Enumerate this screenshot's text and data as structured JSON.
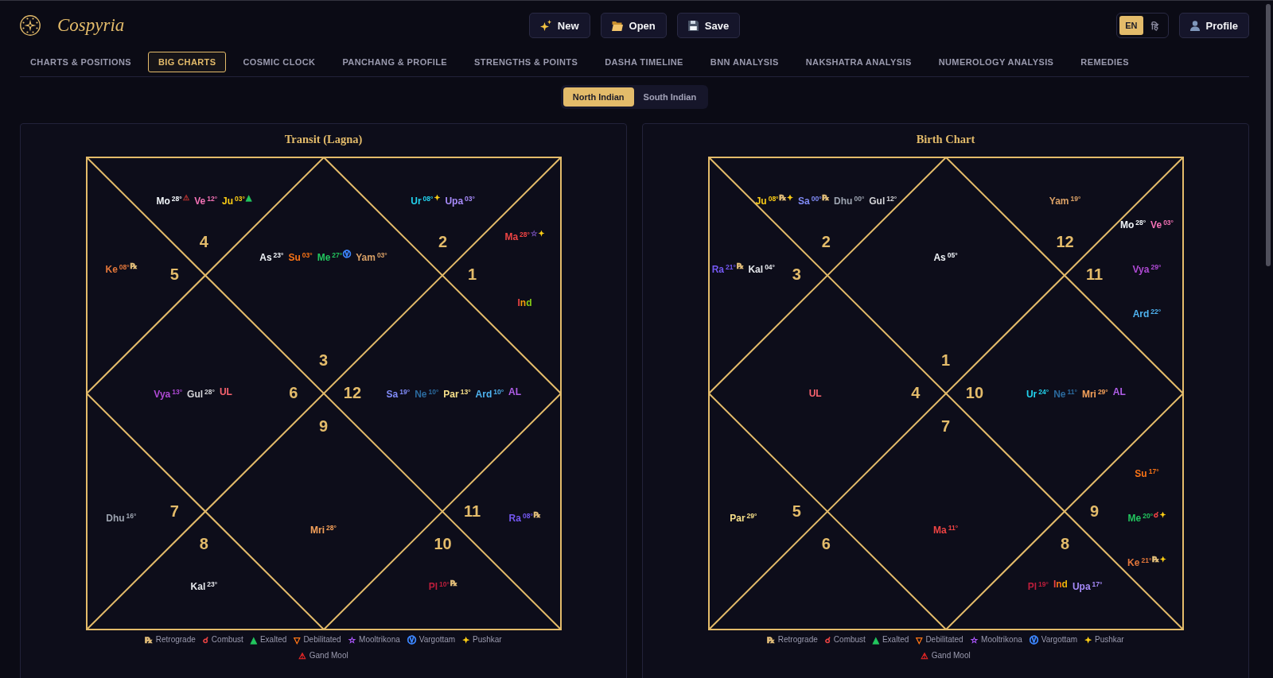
{
  "header": {
    "brand": "Cospyria",
    "buttons": [
      {
        "kind": "new",
        "label": "New"
      },
      {
        "kind": "open",
        "label": "Open"
      },
      {
        "kind": "save",
        "label": "Save"
      }
    ],
    "languages": [
      {
        "label": "EN",
        "selected": true
      },
      {
        "label": "हि",
        "selected": false
      }
    ],
    "profile": {
      "label": "Profile"
    }
  },
  "tabs": [
    {
      "label": "CHARTS & POSITIONS",
      "selected": false
    },
    {
      "label": "BIG CHARTS",
      "selected": true
    },
    {
      "label": "COSMIC CLOCK",
      "selected": false
    },
    {
      "label": "PANCHANG & PROFILE",
      "selected": false
    },
    {
      "label": "STRENGTHS & POINTS",
      "selected": false
    },
    {
      "label": "DASHA TIMELINE",
      "selected": false
    },
    {
      "label": "BNN ANALYSIS",
      "selected": false
    },
    {
      "label": "NAKSHATRA ANALYSIS",
      "selected": false
    },
    {
      "label": "NUMEROLOGY ANALYSIS",
      "selected": false
    },
    {
      "label": "REMEDIES",
      "selected": false
    }
  ],
  "chart_styles": [
    {
      "label": "North Indian",
      "selected": true
    },
    {
      "label": "South Indian",
      "selected": false
    }
  ],
  "charts": [
    {
      "title": "Transit (Lagna)",
      "houses": [
        {
          "sign": "3",
          "rows": [
            [
              {
                "name": "As",
                "degree": "23°",
                "color": "#f1f5f9"
              },
              {
                "name": "Su",
                "degree": "03°",
                "color": "#f97316"
              },
              {
                "name": "Me",
                "degree": "27°",
                "color": "#22c55e",
                "marks": [
                  {
                    "symbol": "Ⓥ",
                    "color": "#3b82f6"
                  }
                ]
              },
              {
                "name": "Yam",
                "degree": "03°",
                "color": "#d9a066"
              }
            ]
          ]
        },
        {
          "sign": "4",
          "rows": [
            [
              {
                "name": "Mo",
                "degree": "28°",
                "color": "#f1f5f9",
                "marks": [
                  {
                    "symbol": "⚠",
                    "color": "#9b2c2c"
                  }
                ]
              },
              {
                "name": "Ve",
                "degree": "12°",
                "color": "#f472b6"
              },
              {
                "name": "Ju",
                "degree": "03°",
                "color": "#facc15",
                "marks": [
                  {
                    "symbol": "▲",
                    "color": "#22c55e"
                  }
                ]
              }
            ]
          ]
        },
        {
          "sign": "5",
          "rows": [
            [
              {
                "name": "Ke",
                "degree": "08°",
                "color": "#e2763a",
                "marks": [
                  {
                    "symbol": "℞",
                    "color": "#e5c07b"
                  }
                ]
              }
            ]
          ]
        },
        {
          "sign": "6",
          "rows": [
            [
              {
                "name": "Vya",
                "degree": "13°",
                "color": "#b04ad6"
              },
              {
                "name": "Gul",
                "degree": "28°",
                "color": "#d4d4d8"
              },
              {
                "name": "UL",
                "color": "#f8636f"
              }
            ]
          ]
        },
        {
          "sign": "7",
          "rows": [
            [
              {
                "name": "Dhu",
                "degree": "16°",
                "color": "#9ca3af"
              }
            ]
          ]
        },
        {
          "sign": "8",
          "rows": [
            [
              {
                "name": "Kal",
                "degree": "23°",
                "color": "#e5e7eb"
              }
            ]
          ]
        },
        {
          "sign": "9",
          "rows": [
            [
              {
                "name": "Mri",
                "degree": "28°",
                "color": "#f6a15a"
              }
            ]
          ]
        },
        {
          "sign": "10",
          "rows": [
            [
              {
                "name": "Pl",
                "degree": "10°",
                "color": "#be1e3c",
                "marks": [
                  {
                    "symbol": "℞",
                    "color": "#e5c07b"
                  }
                ]
              }
            ]
          ]
        },
        {
          "sign": "11",
          "rows": [
            [
              {
                "name": "Ra",
                "degree": "08°",
                "color": "#7458f2",
                "marks": [
                  {
                    "symbol": "℞",
                    "color": "#e5c07b"
                  }
                ]
              }
            ]
          ]
        },
        {
          "sign": "12",
          "rows": [
            [
              {
                "name": "Sa",
                "degree": "19°",
                "color": "#818cf8"
              },
              {
                "name": "Ne",
                "degree": "10°",
                "color": "#2b6a9e"
              },
              {
                "name": "Par",
                "degree": "13°",
                "color": "#f7e08a"
              },
              {
                "name": "Ard",
                "degree": "10°",
                "color": "#4fb3f0"
              },
              {
                "name": "AL",
                "color": "#b05ee8"
              }
            ]
          ]
        },
        {
          "sign": "1",
          "rows": [
            [
              {
                "name": "Ma",
                "degree": "28°",
                "color": "#ef4444",
                "marks": [
                  {
                    "symbol": "☆",
                    "color": "#6d4aa8"
                  },
                  {
                    "symbol": "✦",
                    "color": "#facc15"
                  }
                ]
              }
            ],
            [
              {
                "parts": [
                  {
                    "text": "I",
                    "color": "#ef4444"
                  },
                  {
                    "text": "n",
                    "color": "#f59e0b"
                  },
                  {
                    "text": "d",
                    "color": "#84cc16"
                  }
                ]
              }
            ]
          ]
        },
        {
          "sign": "2",
          "rows": [
            [
              {
                "name": "Ur",
                "degree": "08°",
                "color": "#22d3ee",
                "marks": [
                  {
                    "symbol": "✦",
                    "color": "#facc15"
                  }
                ]
              },
              {
                "name": "Upa",
                "degree": "03°",
                "color": "#a78bfa"
              }
            ]
          ]
        }
      ],
      "legend": [
        {
          "symbol": "℞",
          "color": "#e5c07b",
          "label": "Retrograde"
        },
        {
          "symbol": "☌",
          "color": "#ef4444",
          "label": "Combust"
        },
        {
          "symbol": "▲",
          "color": "#22c55e",
          "label": "Exalted"
        },
        {
          "symbol": "▽",
          "color": "#f97316",
          "label": "Debilitated"
        },
        {
          "symbol": "☆",
          "color": "#a855f7",
          "label": "Mooltrikona"
        },
        {
          "symbol": "Ⓥ",
          "color": "#3b82f6",
          "label": "Vargottam"
        },
        {
          "symbol": "✦",
          "color": "#facc15",
          "label": "Pushkar"
        },
        {
          "symbol": "⚠",
          "color": "#dc2626",
          "label": "Gand Mool"
        }
      ]
    },
    {
      "title": "Birth Chart",
      "houses": [
        {
          "sign": "1",
          "rows": [
            [
              {
                "name": "As",
                "degree": "05°",
                "color": "#f1f5f9"
              }
            ]
          ]
        },
        {
          "sign": "2",
          "rows": [
            [
              {
                "name": "Ju",
                "degree": "08°",
                "color": "#facc15",
                "marks": [
                  {
                    "symbol": "℞",
                    "color": "#e5c07b"
                  },
                  {
                    "symbol": "✦",
                    "color": "#facc15"
                  }
                ]
              },
              {
                "name": "Sa",
                "degree": "00°",
                "color": "#818cf8",
                "marks": [
                  {
                    "symbol": "℞",
                    "color": "#e5c07b"
                  }
                ]
              },
              {
                "name": "Dhu",
                "degree": "00°",
                "color": "#9ca3af"
              },
              {
                "name": "Gul",
                "degree": "12°",
                "color": "#d4d4d8"
              }
            ]
          ]
        },
        {
          "sign": "3",
          "rows": [
            [
              {
                "name": "Ra",
                "degree": "21°",
                "color": "#7458f2",
                "marks": [
                  {
                    "symbol": "℞",
                    "color": "#e5c07b"
                  }
                ]
              },
              {
                "name": "Kal",
                "degree": "04°",
                "color": "#e5e7eb"
              }
            ]
          ]
        },
        {
          "sign": "4",
          "rows": [
            [
              {
                "name": "UL",
                "color": "#f8636f"
              }
            ]
          ]
        },
        {
          "sign": "5",
          "rows": [
            [
              {
                "name": "Par",
                "degree": "29°",
                "color": "#f7e08a"
              }
            ]
          ]
        },
        {
          "sign": "6"
        },
        {
          "sign": "7",
          "rows": [
            [
              {
                "name": "Ma",
                "degree": "11°",
                "color": "#ef4444"
              }
            ]
          ]
        },
        {
          "sign": "8",
          "rows": [
            [
              {
                "name": "Pl",
                "degree": "19°",
                "color": "#be1e3c"
              },
              {
                "parts": [
                  {
                    "text": "I",
                    "color": "#ef4444"
                  },
                  {
                    "text": "n",
                    "color": "#f97316"
                  },
                  {
                    "text": "d",
                    "color": "#eab308"
                  }
                ]
              },
              {
                "name": "Upa",
                "degree": "17°",
                "color": "#a78bfa"
              }
            ]
          ]
        },
        {
          "sign": "9",
          "rows": [
            [
              {
                "name": "Su",
                "degree": "17°",
                "color": "#f97316"
              }
            ],
            [
              {
                "name": "Me",
                "degree": "20°",
                "color": "#22c55e",
                "marks": [
                  {
                    "symbol": "☌",
                    "color": "#ef4444"
                  },
                  {
                    "symbol": "✦",
                    "color": "#facc15"
                  }
                ]
              }
            ],
            [
              {
                "name": "Ke",
                "degree": "21°",
                "color": "#e2763a",
                "marks": [
                  {
                    "symbol": "℞",
                    "color": "#e5c07b"
                  },
                  {
                    "symbol": "✦",
                    "color": "#facc15"
                  }
                ]
              }
            ]
          ]
        },
        {
          "sign": "10",
          "rows": [
            [
              {
                "name": "Ur",
                "degree": "24°",
                "color": "#22d3ee"
              },
              {
                "name": "Ne",
                "degree": "11°",
                "color": "#2b6a9e"
              },
              {
                "name": "Mri",
                "degree": "29°",
                "color": "#f6a15a"
              },
              {
                "name": "AL",
                "color": "#b05ee8"
              }
            ]
          ]
        },
        {
          "sign": "11",
          "rows": [
            [
              {
                "name": "Mo",
                "degree": "28°",
                "color": "#f1f5f9"
              },
              {
                "name": "Ve",
                "degree": "03°",
                "color": "#f472b6"
              }
            ],
            [
              {
                "name": "Vya",
                "degree": "29°",
                "color": "#b04ad6"
              }
            ],
            [
              {
                "name": "Ard",
                "degree": "22°",
                "color": "#4fb3f0"
              }
            ]
          ]
        },
        {
          "sign": "12",
          "rows": [
            [
              {
                "name": "Yam",
                "degree": "19°",
                "color": "#d9a066"
              }
            ]
          ]
        }
      ],
      "legend": [
        {
          "symbol": "℞",
          "color": "#e5c07b",
          "label": "Retrograde"
        },
        {
          "symbol": "☌",
          "color": "#ef4444",
          "label": "Combust"
        },
        {
          "symbol": "▲",
          "color": "#22c55e",
          "label": "Exalted"
        },
        {
          "symbol": "▽",
          "color": "#f97316",
          "label": "Debilitated"
        },
        {
          "symbol": "☆",
          "color": "#a855f7",
          "label": "Mooltrikona"
        },
        {
          "symbol": "Ⓥ",
          "color": "#3b82f6",
          "label": "Vargottam"
        },
        {
          "symbol": "✦",
          "color": "#facc15",
          "label": "Pushkar"
        },
        {
          "symbol": "⚠",
          "color": "#dc2626",
          "label": "Gand Mool"
        }
      ]
    }
  ]
}
